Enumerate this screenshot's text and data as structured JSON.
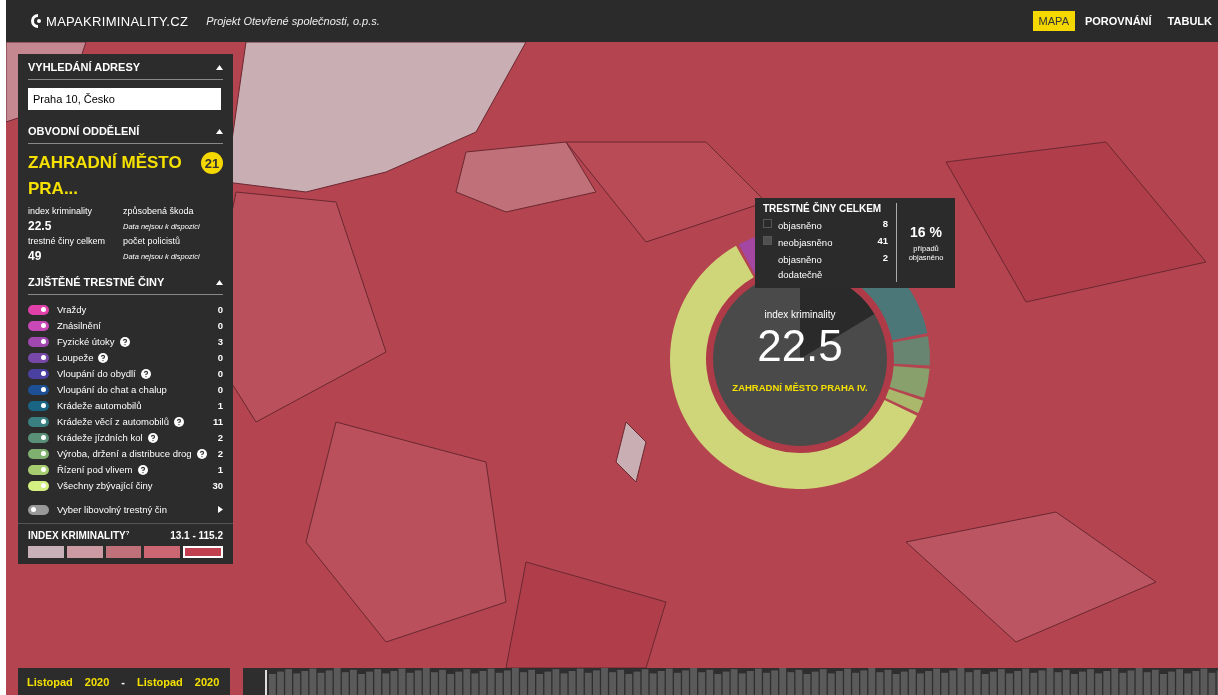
{
  "header": {
    "logo": "MAPAKRIMINALITY.CZ",
    "subtitle": "Projekt Otevřené společnosti, o.p.s.",
    "tabs": [
      {
        "label": "MAPA",
        "selected": true
      },
      {
        "label": "POROVNÁNÍ",
        "selected": false
      },
      {
        "label": "TABULK",
        "selected": false
      }
    ]
  },
  "address": {
    "title": "VYHLEDÁNÍ ADRESY",
    "expanded": true,
    "value": "Praha 10, Česko"
  },
  "district": {
    "title": "OBVODNÍ ODDĚLENÍ",
    "expanded": true,
    "name": "ZAHRADNÍ MĚSTO PRA...",
    "badge": "21",
    "stats": [
      {
        "label": "index kriminality",
        "value": "22.5",
        "kind": "value"
      },
      {
        "label": "způsobená škoda",
        "value": "Data nejsou k dispozici",
        "kind": "note"
      },
      {
        "label": "trestné činy celkem",
        "value": "49",
        "kind": "value"
      },
      {
        "label": "počet policistů",
        "value": "Data nejsou k dispozici",
        "kind": "note"
      }
    ]
  },
  "crimes": {
    "title": "ZJIŠTĚNÉ TRESTNÉ ČINY",
    "expanded": true,
    "items": [
      {
        "label": "Vraždy",
        "count": "0",
        "help": false,
        "on": true,
        "color": "#e040a8"
      },
      {
        "label": "Znásilnění",
        "count": "0",
        "help": false,
        "on": true,
        "color": "#c848b8"
      },
      {
        "label": "Fyzické útoky",
        "count": "3",
        "help": true,
        "on": true,
        "color": "#a048b0"
      },
      {
        "label": "Loupeže",
        "count": "0",
        "help": true,
        "on": true,
        "color": "#7848a8"
      },
      {
        "label": "Vloupání do obydlí",
        "count": "0",
        "help": true,
        "on": true,
        "color": "#4a40a0"
      },
      {
        "label": "Vloupání do chat a chalup",
        "count": "0",
        "help": false,
        "on": true,
        "color": "#1c4f94"
      },
      {
        "label": "Krádeže automobilů",
        "count": "1",
        "help": false,
        "on": true,
        "color": "#1a6484"
      },
      {
        "label": "Krádeže věcí z automobilů",
        "count": "11",
        "help": true,
        "on": true,
        "color": "#3a8080"
      },
      {
        "label": "Krádeže jízdních kol",
        "count": "2",
        "help": true,
        "on": true,
        "color": "#5a9078"
      },
      {
        "label": "Výroba, držení a distribuce drog",
        "count": "2",
        "help": true,
        "on": true,
        "color": "#80b070"
      },
      {
        "label": "Řízení pod vlivem",
        "count": "1",
        "help": true,
        "on": true,
        "color": "#a8cc70"
      },
      {
        "label": "Všechny zbývající činy",
        "count": "30",
        "help": false,
        "on": true,
        "color": "#d4f080"
      }
    ],
    "other": {
      "label": "Vyber libovolný trestný čin",
      "on": false
    }
  },
  "legend": {
    "title": "INDEX KRIMINALITY",
    "note": "?",
    "range": "13.1 - 115.2",
    "swatches": [
      {
        "color": "#c8b0b8",
        "selected": false
      },
      {
        "color": "#cc9aa2",
        "selected": false
      },
      {
        "color": "#c07078",
        "selected": false
      },
      {
        "color": "#cc6672",
        "selected": false
      },
      {
        "color": "#c04050",
        "selected": true
      }
    ]
  },
  "donut": {
    "label": "index kriminality",
    "value": "22.5",
    "name": "ZAHRADNÍ MĚSTO PRAHA IV."
  },
  "tooltip": {
    "title": "TRESTNÉ ČINY CELKEM",
    "rows": [
      {
        "label": "objasněno",
        "value": "8",
        "color": "#2a2a2a"
      },
      {
        "label": "neobjasněno",
        "value": "41",
        "color": "#505050"
      },
      {
        "label": "objasněno dodatečně",
        "value": "2"
      }
    ],
    "percent": "16 %",
    "percent_label": "případů objasněno"
  },
  "timeline": {
    "from_month": "Listopad",
    "from_year": "2020",
    "separator": "-",
    "to_month": "Listopad",
    "to_year": "2020"
  }
}
